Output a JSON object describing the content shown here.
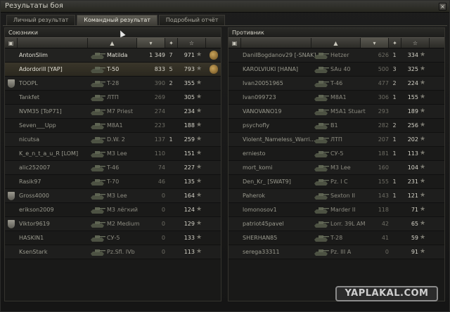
{
  "window": {
    "title": "Результаты боя",
    "close_label": "×"
  },
  "tabs": [
    {
      "label": "Личный результат",
      "active": false
    },
    {
      "label": "Командный результат",
      "active": true
    },
    {
      "label": "Подробный отчёт",
      "active": false
    }
  ],
  "allies": {
    "header": "Союзники",
    "rows": [
      {
        "player": "AntonSlim",
        "tank": "Matilda",
        "damage": "1 349",
        "kills": "7",
        "xp": "971",
        "clan_icon": false,
        "medal": true,
        "highlight": "top"
      },
      {
        "player": "Adordorill [YAP]",
        "tank": "T-50",
        "damage": "833",
        "kills": "5",
        "xp": "793",
        "clan_icon": false,
        "medal": true,
        "highlight": "me"
      },
      {
        "player": "TOOPL",
        "tank": "T-28",
        "damage": "390",
        "kills": "2",
        "xp": "355",
        "clan_icon": true,
        "medal": false,
        "highlight": ""
      },
      {
        "player": "Tankfet",
        "tank": "ЛТП",
        "damage": "269",
        "kills": "",
        "xp": "305",
        "clan_icon": false,
        "medal": false,
        "highlight": ""
      },
      {
        "player": "NVM35 [ToP71]",
        "tank": "M7 Priest",
        "damage": "274",
        "kills": "",
        "xp": "234",
        "clan_icon": false,
        "medal": false,
        "highlight": ""
      },
      {
        "player": "Seven___Upp",
        "tank": "M8A1",
        "damage": "223",
        "kills": "",
        "xp": "188",
        "clan_icon": false,
        "medal": false,
        "highlight": ""
      },
      {
        "player": "nicutsa",
        "tank": "D.W. 2",
        "damage": "137",
        "kills": "1",
        "xp": "259",
        "clan_icon": false,
        "medal": false,
        "highlight": ""
      },
      {
        "player": "K_e_n_t_a_u_R [LOM]",
        "tank": "M3 Lee",
        "damage": "110",
        "kills": "",
        "xp": "151",
        "clan_icon": false,
        "medal": false,
        "highlight": ""
      },
      {
        "player": "alic252007",
        "tank": "T-46",
        "damage": "74",
        "kills": "",
        "xp": "227",
        "clan_icon": false,
        "medal": false,
        "highlight": ""
      },
      {
        "player": "Rasik97",
        "tank": "T-70",
        "damage": "46",
        "kills": "",
        "xp": "135",
        "clan_icon": false,
        "medal": false,
        "highlight": ""
      },
      {
        "player": "Gross4000",
        "tank": "M3 Lee",
        "damage": "0",
        "kills": "",
        "xp": "164",
        "clan_icon": true,
        "medal": false,
        "highlight": ""
      },
      {
        "player": "erikson2009",
        "tank": "M3 лёгкий",
        "damage": "0",
        "kills": "",
        "xp": "124",
        "clan_icon": false,
        "medal": false,
        "highlight": ""
      },
      {
        "player": "Viktor9619",
        "tank": "M2 Medium",
        "damage": "0",
        "kills": "",
        "xp": "129",
        "clan_icon": true,
        "medal": false,
        "highlight": ""
      },
      {
        "player": "HASKIN1",
        "tank": "СУ-5",
        "damage": "0",
        "kills": "",
        "xp": "133",
        "clan_icon": false,
        "medal": false,
        "highlight": ""
      },
      {
        "player": "KsenStark",
        "tank": "Pz.Sfl. IVb",
        "damage": "0",
        "kills": "",
        "xp": "113",
        "clan_icon": false,
        "medal": false,
        "highlight": ""
      }
    ]
  },
  "enemies": {
    "header": "Противник",
    "rows": [
      {
        "player": "DaniIBogdanov29 [-SNAK]",
        "tank": "Hetzer",
        "damage": "626",
        "kills": "1",
        "xp": "334"
      },
      {
        "player": "KAROLVIUKI [HANA]",
        "tank": "SAu 40",
        "damage": "500",
        "kills": "3",
        "xp": "325"
      },
      {
        "player": "Ivan20051965",
        "tank": "T-46",
        "damage": "477",
        "kills": "2",
        "xp": "224"
      },
      {
        "player": "Ivan099723",
        "tank": "M8A1",
        "damage": "306",
        "kills": "1",
        "xp": "155"
      },
      {
        "player": "VANOVANO19",
        "tank": "M5A1 Stuart",
        "damage": "293",
        "kills": "",
        "xp": "189"
      },
      {
        "player": "psychofly",
        "tank": "B1",
        "damage": "282",
        "kills": "2",
        "xp": "256"
      },
      {
        "player": "Violent_Nameless_Warri...",
        "tank": "ЛТП",
        "damage": "207",
        "kills": "1",
        "xp": "202"
      },
      {
        "player": "erniesto",
        "tank": "СУ-5",
        "damage": "181",
        "kills": "1",
        "xp": "113"
      },
      {
        "player": "mort_komi",
        "tank": "M3 Lee",
        "damage": "160",
        "kills": "",
        "xp": "104"
      },
      {
        "player": "Den_Kr_ [SWAT9]",
        "tank": "Pz. I C",
        "damage": "155",
        "kills": "1",
        "xp": "231"
      },
      {
        "player": "Paherok",
        "tank": "Sexton II",
        "damage": "143",
        "kills": "1",
        "xp": "121"
      },
      {
        "player": "lomonosov1",
        "tank": "Marder II",
        "damage": "118",
        "kills": "",
        "xp": "71"
      },
      {
        "player": "patriot45pavel",
        "tank": "Lorr. 39L AM",
        "damage": "42",
        "kills": "",
        "xp": "65"
      },
      {
        "player": "SHERHAN85",
        "tank": "T-28",
        "damage": "41",
        "kills": "",
        "xp": "59"
      },
      {
        "player": "serega33311",
        "tank": "Pz. III A",
        "damage": "0",
        "kills": "",
        "xp": "91"
      }
    ]
  },
  "watermark": "YAPLAKAL.COM",
  "colors": {
    "accent": "#c9a35a",
    "background": "#141414",
    "text": "#9a9a8e"
  },
  "icons": {
    "star": "★",
    "sort_active": "▾",
    "sort_clan": "▣",
    "sort_tank": "▲",
    "sort_damage": "✦",
    "sort_xp": "☆"
  }
}
